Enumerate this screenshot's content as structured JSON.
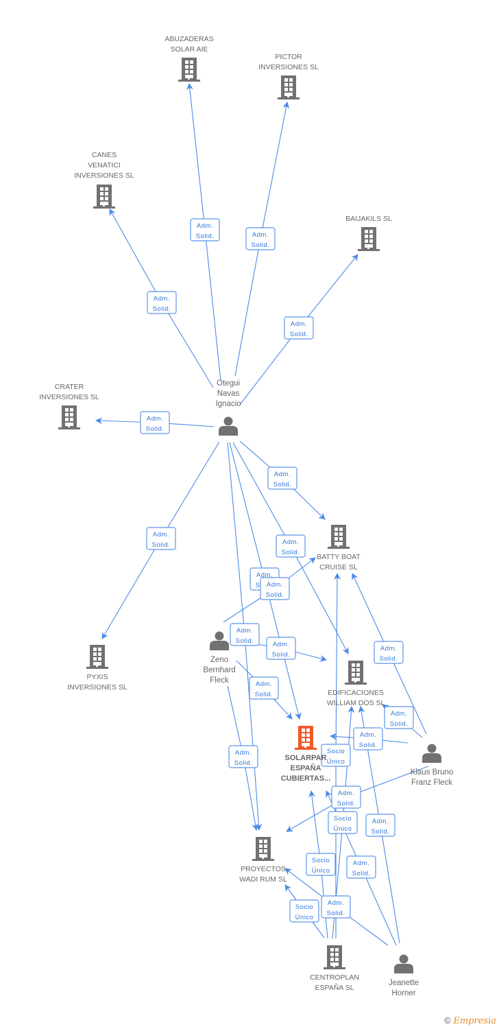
{
  "colors": {
    "edge": "#4a8ae6",
    "company": "#717171",
    "main_company": "#f05a28",
    "person": "#717171",
    "label_text": "#2f73d8"
  },
  "nodes": [
    {
      "id": "abuzaderas",
      "type": "company",
      "name": [
        "ABUZADERAS",
        "SOLAR AIE"
      ]
    },
    {
      "id": "pictor",
      "type": "company",
      "name": [
        "PICTOR",
        "INVERSIONES SL"
      ]
    },
    {
      "id": "canes",
      "type": "company",
      "name": [
        "CANES",
        "VENATICI",
        "INVERSIONES SL"
      ]
    },
    {
      "id": "baijakils",
      "type": "company",
      "name": [
        "BAIJAKILS SL"
      ]
    },
    {
      "id": "crater",
      "type": "company",
      "name": [
        "CRATER",
        "INVERSIONES SL"
      ]
    },
    {
      "id": "otegui",
      "type": "person",
      "name": [
        "Otegui",
        "Navas",
        "Ignacio"
      ]
    },
    {
      "id": "batty",
      "type": "company",
      "name": [
        "BATTY BOAT",
        "CRUISE SL"
      ]
    },
    {
      "id": "pyxis",
      "type": "company",
      "name": [
        "PYXIS",
        "INVERSIONES SL"
      ]
    },
    {
      "id": "zeno",
      "type": "person",
      "name": [
        "Zeno",
        "Bernhard",
        "Fleck"
      ]
    },
    {
      "id": "edificaciones",
      "type": "company",
      "name": [
        "EDIFICACIONES",
        "WILLIAM DOS SL"
      ]
    },
    {
      "id": "solarpar",
      "type": "main",
      "name": [
        "SOLARPAR",
        "ESPAÑA",
        "CUBIERTAS..."
      ]
    },
    {
      "id": "klaus",
      "type": "person",
      "name": [
        "Klaus Bruno",
        "Franz Fleck"
      ]
    },
    {
      "id": "proyectos",
      "type": "company",
      "name": [
        "PROYECTOS",
        "WADI RUM SL"
      ]
    },
    {
      "id": "centroplan",
      "type": "company",
      "name": [
        "CENTROPLAN",
        "ESPAÑA SL"
      ]
    },
    {
      "id": "jeanette",
      "type": "person",
      "name": [
        "Jeanette",
        "Horner"
      ]
    }
  ],
  "edges": [
    {
      "from": "otegui",
      "to": "abuzaderas",
      "label": [
        "Adm.",
        "Solid."
      ]
    },
    {
      "from": "otegui",
      "to": "pictor",
      "label": [
        "Adm.",
        "Solid."
      ]
    },
    {
      "from": "otegui",
      "to": "canes",
      "label": [
        "Adm.",
        "Solid."
      ]
    },
    {
      "from": "otegui",
      "to": "baijakils",
      "label": [
        "Adm.",
        "Solid."
      ]
    },
    {
      "from": "otegui",
      "to": "crater",
      "label": [
        "Adm.",
        "Solid."
      ]
    },
    {
      "from": "otegui",
      "to": "pyxis",
      "label": [
        "Adm.",
        "Solid."
      ]
    },
    {
      "from": "otegui",
      "to": "batty",
      "label": [
        "Adm.",
        "Solid."
      ]
    },
    {
      "from": "otegui",
      "to": "edificaciones",
      "label": [
        "Adm.",
        "Solid."
      ]
    },
    {
      "from": "otegui",
      "to": "solarpar",
      "label": [
        "Adm.",
        "Solid."
      ]
    },
    {
      "from": "otegui",
      "to": "proyectos",
      "label": [
        "Adm.",
        "Solid."
      ]
    },
    {
      "from": "zeno",
      "to": "batty",
      "label": [
        "Adm.",
        "Solid."
      ]
    },
    {
      "from": "zeno",
      "to": "edificaciones",
      "label": [
        "Adm.",
        "Solid."
      ]
    },
    {
      "from": "zeno",
      "to": "solarpar",
      "label": [
        "Adm.",
        "Solid."
      ]
    },
    {
      "from": "zeno",
      "to": "proyectos",
      "label": [
        "Adm.",
        "Solid."
      ]
    },
    {
      "from": "klaus",
      "to": "batty",
      "label": [
        "Adm.",
        "Solid."
      ]
    },
    {
      "from": "klaus",
      "to": "edificaciones",
      "label": [
        "Adm.",
        "Solid."
      ]
    },
    {
      "from": "klaus",
      "to": "solarpar",
      "label": [
        "Adm.",
        "Solid."
      ]
    },
    {
      "from": "klaus",
      "to": "proyectos",
      "label": [
        "Adm.",
        "Solid."
      ]
    },
    {
      "from": "centroplan",
      "to": "batty",
      "label": [
        "Socio",
        "Único"
      ]
    },
    {
      "from": "centroplan",
      "to": "edificaciones",
      "label": [
        "Socio",
        "Único"
      ]
    },
    {
      "from": "centroplan",
      "to": "solarpar",
      "label": [
        "Socio",
        "Único"
      ]
    },
    {
      "from": "centroplan",
      "to": "proyectos",
      "label": [
        "Socio",
        "Único"
      ]
    },
    {
      "from": "jeanette",
      "to": "edificaciones",
      "label": [
        "Adm.",
        "Solid."
      ]
    },
    {
      "from": "jeanette",
      "to": "solarpar",
      "label": [
        "Adm.",
        "Solid."
      ]
    },
    {
      "from": "jeanette",
      "to": "proyectos",
      "label": [
        "Adm.",
        "Solid."
      ]
    }
  ],
  "footer": {
    "copyright": "©",
    "brand": "Empresia"
  }
}
